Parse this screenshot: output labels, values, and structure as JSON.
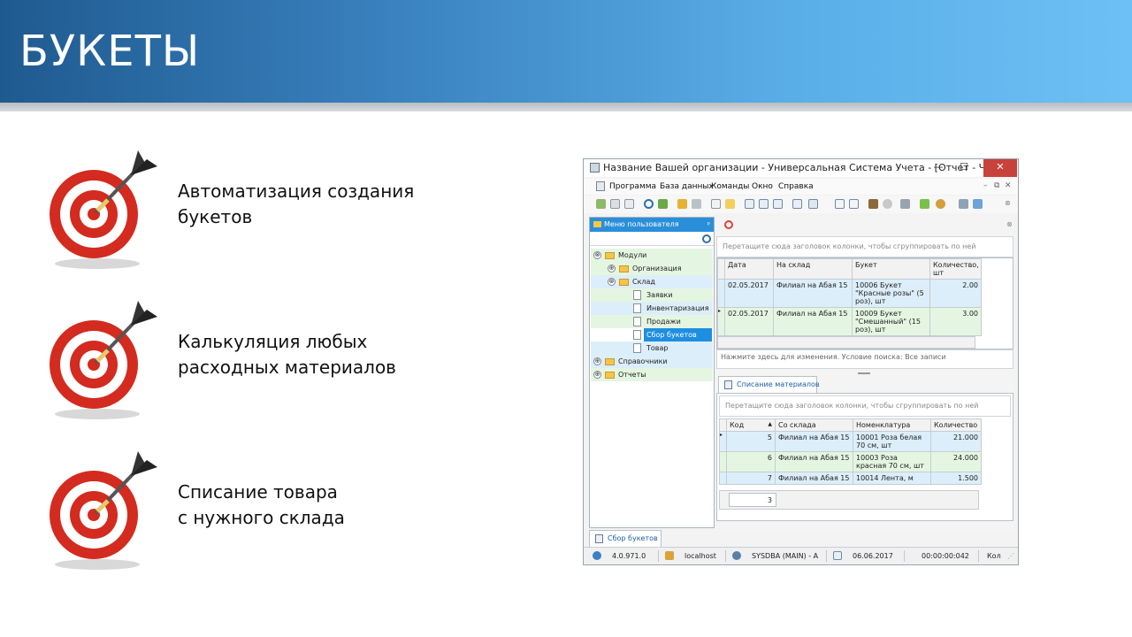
{
  "slide": {
    "title": "БУКЕТЫ",
    "bullets": [
      {
        "line1": "Автоматизация создания",
        "line2": "букетов",
        "icon": "target-dart-icon"
      },
      {
        "line1": "Калькуляция любых",
        "line2": "расходных материалов",
        "icon": "target-dart-icon"
      },
      {
        "line1": "Списание товара",
        "line2": "с нужного склада",
        "icon": "target-dart-icon"
      }
    ]
  },
  "app": {
    "title": "Название Вашей организации - Универсальная Система Учета - [Отчет - Ч...",
    "window_controls": {
      "minimize": "—",
      "maximize": "☐",
      "close": "✕"
    },
    "menu": [
      "Программа",
      "База данных",
      "Команды",
      "Окно",
      "Справка"
    ],
    "mdi_controls": [
      "–",
      "⧉",
      "✕",
      "⊗"
    ],
    "left_panel": {
      "header": "Меню пользователя",
      "tree": [
        {
          "label": "Модули",
          "level": 0,
          "expander": "⊗",
          "kind": "folder"
        },
        {
          "label": "Организация",
          "level": 1,
          "expander": "⊕",
          "kind": "folder"
        },
        {
          "label": "Склад",
          "level": 1,
          "expander": "⊗",
          "kind": "folder"
        },
        {
          "label": "Заявки",
          "level": 2,
          "kind": "doc"
        },
        {
          "label": "Инвентаризация",
          "level": 2,
          "kind": "doc"
        },
        {
          "label": "Продажи",
          "level": 2,
          "kind": "doc"
        },
        {
          "label": "Сбор букетов",
          "level": 2,
          "kind": "doc",
          "selected": true
        },
        {
          "label": "Товар",
          "level": 2,
          "kind": "doc"
        },
        {
          "label": "Справочники",
          "level": 0,
          "expander": "⊕",
          "kind": "folder"
        },
        {
          "label": "Отчеты",
          "level": 0,
          "expander": "⊕",
          "kind": "folder"
        }
      ]
    },
    "top_grid": {
      "group_hint": "Перетащите сюда заголовок колонки, чтобы сгруппировать по ней",
      "columns": [
        "Дата",
        "На склад",
        "Букет",
        "Количество, шт"
      ],
      "rows": [
        [
          "02.05.2017",
          "Филиал на Абая 15",
          "10006 Букет \"Красные розы\" (5 роз), шт",
          "2.00"
        ],
        [
          "02.05.2017",
          "Филиал на Абая 15",
          "10009 Букет \"Смешанный\" (15 роз), шт",
          "3.00"
        ]
      ],
      "filter_status": "Нажмите здесь для изменения. Условие поиска: Все записи"
    },
    "detail": {
      "tab_label": "Списание материалов",
      "group_hint": "Перетащите сюда заголовок колонки, чтобы сгруппировать по ней",
      "columns": [
        "Код",
        "Со склада",
        "Номенклатура",
        "Количество"
      ],
      "sort_glyph": "▲",
      "rows": [
        [
          "5",
          "Филиал на Абая 15",
          "10001 Роза белая 70 см, шт",
          "21.000"
        ],
        [
          "6",
          "Филиал на Абая 15",
          "10003 Роза красная 70 см, шт",
          "24.000"
        ],
        [
          "7",
          "Филиал на Абая 15",
          "10014 Лента, м",
          "1.500"
        ]
      ],
      "footer_count": "3"
    },
    "bottom_tab": "Сбор букетов",
    "statusbar": {
      "version": "4.0.971.0",
      "host": "localhost",
      "user": "SYSDBA (MAIN) - A",
      "date": "06.06.2017",
      "time": "00:00:00:042",
      "extra": "Кол"
    }
  }
}
